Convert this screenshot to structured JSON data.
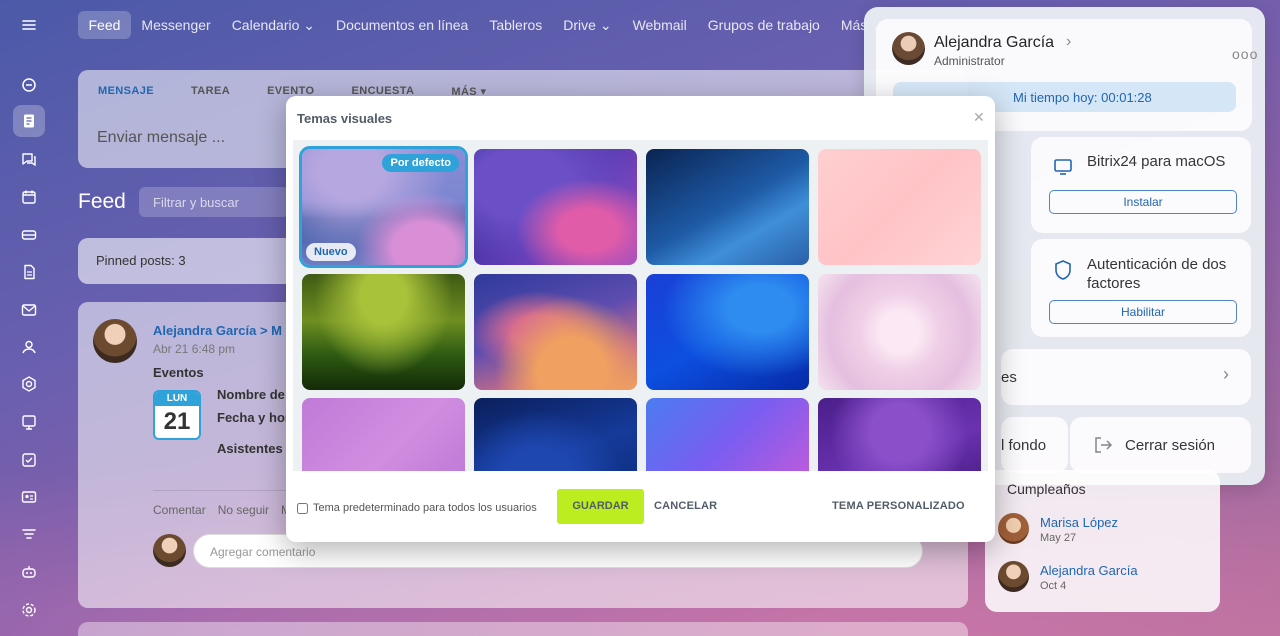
{
  "topnav": {
    "items": [
      "Feed",
      "Messenger",
      "Calendario ⌄",
      "Documentos en línea",
      "Tableros",
      "Drive ⌄",
      "Webmail",
      "Grupos de trabajo",
      "Más ⌄"
    ]
  },
  "composer": {
    "tabs": [
      "MENSAJE",
      "TAREA",
      "EVENTO",
      "ENCUESTA",
      "MÁS ▾"
    ],
    "placeholder": "Enviar mensaje ..."
  },
  "feed": {
    "title": "Feed",
    "filter_placeholder": "Filtrar y buscar",
    "pinned": "Pinned posts: 3"
  },
  "post": {
    "author": "Alejandra García  >  M",
    "date": "Abr 21 6:48 pm",
    "type": "Eventos",
    "calendar_day_name": "LUN",
    "calendar_day": "21",
    "field_name": "Nombre de",
    "field_time": "Fecha y hor",
    "field_attendees": "Asistentes",
    "actions": [
      "Comentar",
      "No seguir",
      "M"
    ],
    "comment_placeholder": "Agregar comentario"
  },
  "profile": {
    "name": "Alejandra García",
    "role": "Administrator",
    "time": "Mi tiempo hoy: 00:01:28",
    "mac_title": "Bitrix24 para macOS",
    "mac_button": "Instalar",
    "twofa_title_1": "Autenticación de dos",
    "twofa_title_2": "factores",
    "twofa_button": "Habilitar",
    "row_es": "es",
    "row_fondo": "l fondo",
    "logout": "Cerrar sesión"
  },
  "birthdays": {
    "title": "Cumpleaños",
    "people": [
      {
        "name": "Marisa López",
        "date": "May 27"
      },
      {
        "name": "Alejandra García",
        "date": "Oct 4"
      }
    ]
  },
  "modal": {
    "title": "Temas visuales",
    "badge_default": "Por defecto",
    "badge_new": "Nuevo",
    "checkbox_label": "Tema predeterminado para todos los usuarios",
    "save": "GUARDAR",
    "cancel": "CANCELAR",
    "custom": "TEMA PERSONALIZADO"
  },
  "colors": {
    "accent_blue": "#2067b0",
    "save_green": "#bbed21",
    "selected_outline": "#2fa3d9"
  }
}
